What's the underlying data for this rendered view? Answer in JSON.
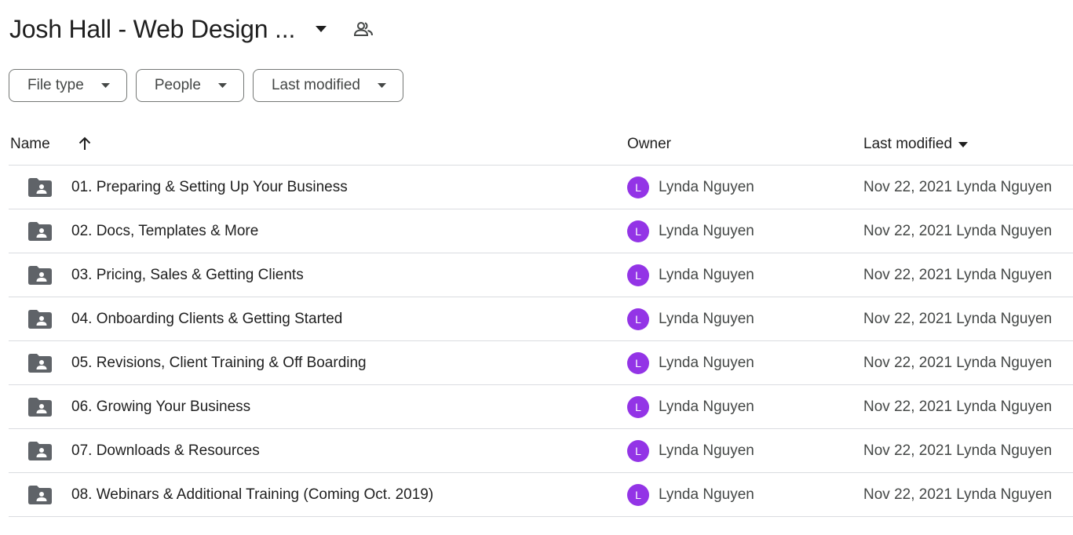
{
  "header": {
    "folder_title": "Josh Hall - Web Design ...",
    "dropdown_icon": "arrow-drop-down-icon",
    "shared_icon": "people-icon"
  },
  "filters": [
    {
      "label": "File type"
    },
    {
      "label": "People"
    },
    {
      "label": "Last modified"
    }
  ],
  "columns": {
    "name": "Name",
    "owner": "Owner",
    "last_modified": "Last modified",
    "sort_icon": "arrow-upward-icon"
  },
  "files": [
    {
      "name": "01. Preparing & Setting Up Your Business",
      "owner_initial": "L",
      "owner": "Lynda Nguyen",
      "modified": "Nov 22, 2021 Lynda Nguyen"
    },
    {
      "name": "02. Docs, Templates & More",
      "owner_initial": "L",
      "owner": "Lynda Nguyen",
      "modified": "Nov 22, 2021 Lynda Nguyen"
    },
    {
      "name": "03. Pricing, Sales & Getting Clients",
      "owner_initial": "L",
      "owner": "Lynda Nguyen",
      "modified": "Nov 22, 2021 Lynda Nguyen"
    },
    {
      "name": "04. Onboarding Clients & Getting Started",
      "owner_initial": "L",
      "owner": "Lynda Nguyen",
      "modified": "Nov 22, 2021 Lynda Nguyen"
    },
    {
      "name": "05. Revisions, Client Training & Off Boarding",
      "owner_initial": "L",
      "owner": "Lynda Nguyen",
      "modified": "Nov 22, 2021 Lynda Nguyen"
    },
    {
      "name": "06. Growing Your Business",
      "owner_initial": "L",
      "owner": "Lynda Nguyen",
      "modified": "Nov 22, 2021 Lynda Nguyen"
    },
    {
      "name": "07. Downloads & Resources",
      "owner_initial": "L",
      "owner": "Lynda Nguyen",
      "modified": "Nov 22, 2021 Lynda Nguyen"
    },
    {
      "name": "08. Webinars & Additional Training (Coming Oct. 2019)",
      "owner_initial": "L",
      "owner": "Lynda Nguyen",
      "modified": "Nov 22, 2021 Lynda Nguyen"
    }
  ],
  "colors": {
    "avatar": "#9334e6",
    "folder_icon": "#5f6368",
    "divider": "#dadce0"
  }
}
